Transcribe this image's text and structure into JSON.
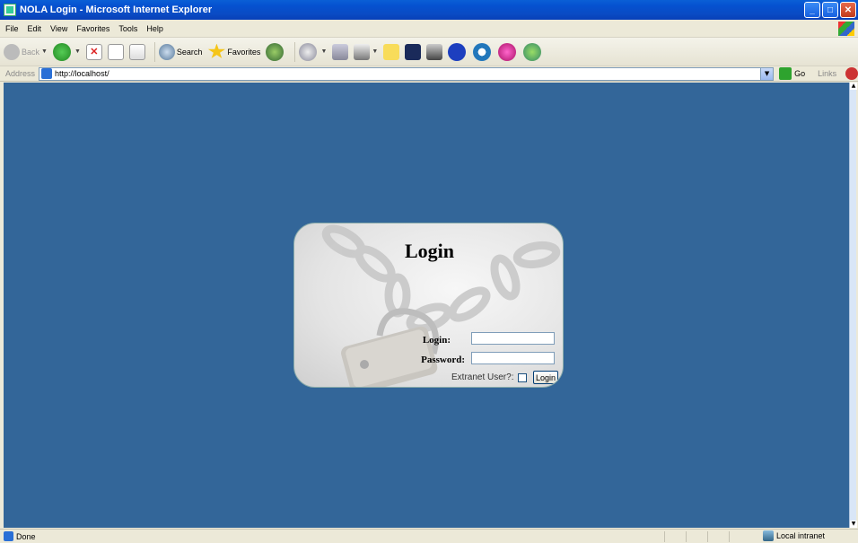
{
  "window": {
    "title": "NOLA Login - Microsoft Internet Explorer"
  },
  "menu": {
    "items": [
      "File",
      "Edit",
      "View",
      "Favorites",
      "Tools",
      "Help"
    ]
  },
  "toolbar": {
    "back_label": "Back",
    "search_label": "Search",
    "favorites_label": "Favorites"
  },
  "address": {
    "label": "Address",
    "url": "http://localhost/",
    "go_label": "Go",
    "links_label": "Links"
  },
  "login": {
    "title": "Login",
    "login_label": "Login:",
    "login_value": "",
    "password_label": "Password:",
    "password_value": "",
    "extranet_label": "Extranet User?:",
    "extranet_checked": false,
    "button_label": "Login"
  },
  "status": {
    "text": "Done",
    "zone": "Local intranet"
  },
  "colors": {
    "content_bg": "#336699",
    "titlebar": "#0a5fd6"
  }
}
